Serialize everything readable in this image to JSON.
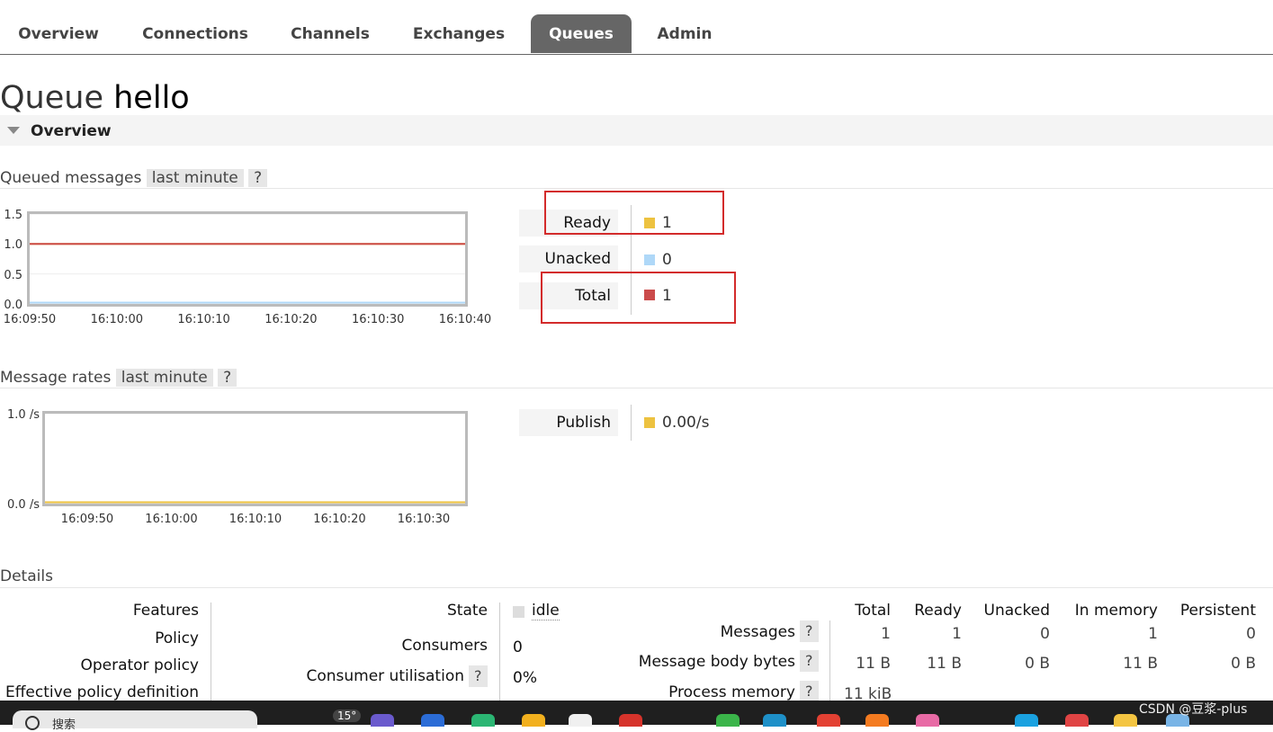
{
  "nav": {
    "tabs": [
      "Overview",
      "Connections",
      "Channels",
      "Exchanges",
      "Queues",
      "Admin"
    ],
    "active": "Queues"
  },
  "page": {
    "title_prefix": "Queue",
    "queue_name": "hello"
  },
  "overview_section": {
    "label": "Overview"
  },
  "queued_messages": {
    "title": "Queued messages",
    "range": "last minute",
    "help": "?",
    "legend": [
      {
        "label": "Ready",
        "value": "1",
        "color": "#edc240"
      },
      {
        "label": "Unacked",
        "value": "0",
        "color": "#afd8f8"
      },
      {
        "label": "Total",
        "value": "1",
        "color": "#cb4b4b"
      }
    ]
  },
  "message_rates": {
    "title": "Message rates",
    "range": "last minute",
    "help": "?",
    "legend": [
      {
        "label": "Publish",
        "value": "0.00/s",
        "color": "#edc240"
      }
    ]
  },
  "chart_data": [
    {
      "type": "line",
      "ylim": [
        0,
        1.5
      ],
      "yticks": [
        "0.0",
        "0.5",
        "1.0",
        "1.5"
      ],
      "x": [
        "16:09:50",
        "16:10:00",
        "16:10:10",
        "16:10:20",
        "16:10:30",
        "16:10:40"
      ],
      "series": [
        {
          "name": "Ready",
          "color": "#edc240",
          "values": [
            1,
            1,
            1,
            1,
            1,
            1
          ]
        },
        {
          "name": "Unacked",
          "color": "#afd8f8",
          "values": [
            0,
            0,
            0,
            0,
            0,
            0
          ]
        },
        {
          "name": "Total",
          "color": "#cb4b4b",
          "values": [
            1,
            1,
            1,
            1,
            1,
            1
          ]
        }
      ]
    },
    {
      "type": "line",
      "ylim": [
        0,
        1.0
      ],
      "yticks": [
        "0.0 /s",
        "1.0 /s"
      ],
      "x": [
        "16:09:50",
        "16:10:00",
        "16:10:10",
        "16:10:20",
        "16:10:30"
      ],
      "series": [
        {
          "name": "Publish",
          "color": "#edc240",
          "values": [
            0,
            0,
            0,
            0,
            0
          ]
        }
      ]
    }
  ],
  "details": {
    "title": "Details",
    "left_labels": [
      "Features",
      "Policy",
      "Operator policy",
      "Effective policy definition"
    ],
    "state_label": "State",
    "state_value": "idle",
    "consumers_label": "Consumers",
    "consumers_value": "0",
    "util_label": "Consumer utilisation",
    "util_value": "0%",
    "help": "?",
    "table": {
      "columns": [
        "Total",
        "Ready",
        "Unacked",
        "In memory",
        "Persistent"
      ],
      "rows": [
        {
          "label": "Messages",
          "values": [
            "1",
            "1",
            "0",
            "1",
            "0"
          ]
        },
        {
          "label": "Message body bytes",
          "values": [
            "11 B",
            "11 B",
            "0 B",
            "11 B",
            "0 B"
          ]
        },
        {
          "label": "Process memory",
          "values": [
            "11 kiB"
          ]
        }
      ]
    }
  },
  "taskbar": {
    "search": "搜索",
    "weather": "15°",
    "watermark": "CSDN @豆浆-plus"
  }
}
